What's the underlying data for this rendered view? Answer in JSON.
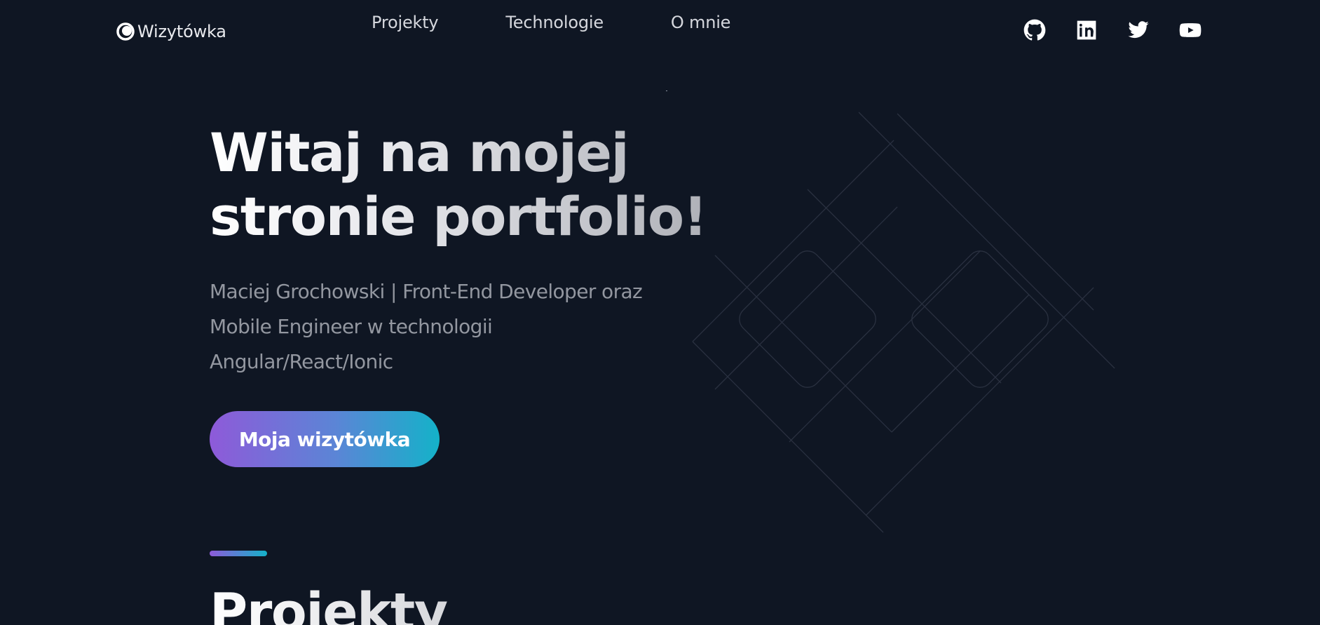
{
  "header": {
    "logo_text": "Wizytówka",
    "logo_icon": "ring-logo-icon",
    "nav": [
      {
        "label": "Projekty"
      },
      {
        "label": "Technologie"
      },
      {
        "label": "O mnie"
      }
    ],
    "social": [
      {
        "icon": "github-icon"
      },
      {
        "icon": "linkedin-icon"
      },
      {
        "icon": "twitter-icon"
      },
      {
        "icon": "youtube-icon"
      }
    ]
  },
  "hero": {
    "title_line1": "Witaj na mojej",
    "title_line2": "stronie portfolio!",
    "subtitle_line1": "Maciej Grochowski | Front-End Developer oraz",
    "subtitle_line2": "Mobile Engineer w technologii",
    "subtitle_line3": "Angular/React/Ionic",
    "cta_label": "Moja wizytówka"
  },
  "section": {
    "title": "Projekty"
  },
  "colors": {
    "background": "#0f1623",
    "accent_start": "#8e5ad9",
    "accent_end": "#14b2c9",
    "subtitle_text": "#9397a0"
  }
}
